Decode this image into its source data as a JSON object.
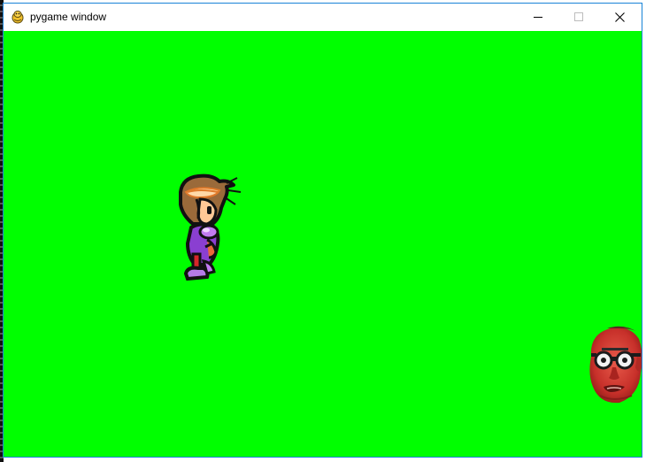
{
  "window": {
    "title": "pygame window",
    "app_icon": "pygame-snake-icon",
    "controls": {
      "minimize_icon": "minimize-icon",
      "maximize_icon": "maximize-icon",
      "close_icon": "close-icon"
    }
  },
  "game": {
    "background_color": "#00ff00",
    "player_sprite": "player-character-sprite",
    "enemy_sprite": "enemy-face-sprite"
  }
}
